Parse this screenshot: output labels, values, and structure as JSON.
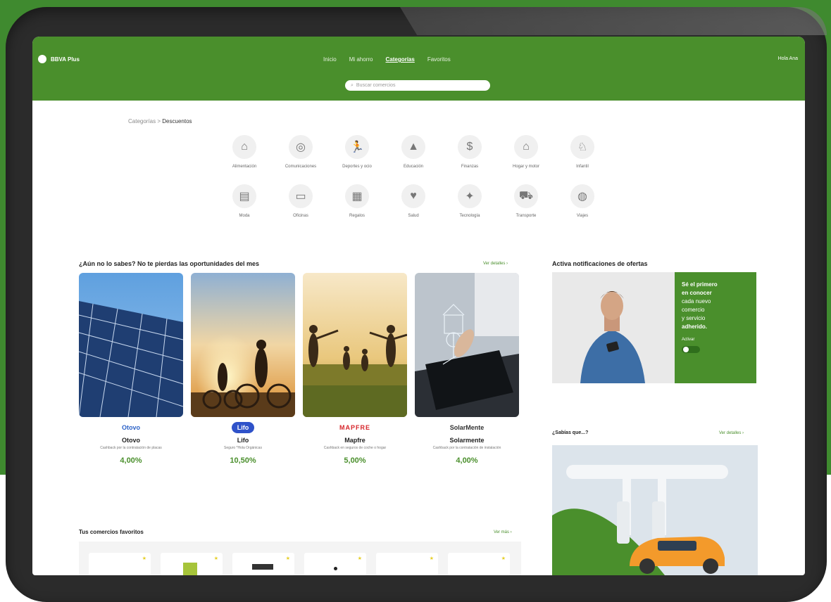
{
  "header": {
    "logo_text": "BBVA Plus",
    "nav": [
      "Inicio",
      "Mi ahorro",
      "Categorías",
      "Favoritos"
    ],
    "active_nav_index": 2,
    "user_label": "Hola Ana",
    "search_placeholder": "Buscar comercios"
  },
  "breadcrumb": {
    "parent": "Categorías",
    "separator": ">",
    "current": "Descuentos"
  },
  "categories": [
    {
      "label": "Alimentación",
      "icon": "basket-icon"
    },
    {
      "label": "Comunicaciones",
      "icon": "camera-icon"
    },
    {
      "label": "Deportes y ocio",
      "icon": "runner-icon"
    },
    {
      "label": "Educación",
      "icon": "graduation-cap-icon"
    },
    {
      "label": "Finanzas",
      "icon": "dollar-icon"
    },
    {
      "label": "Hogar y motor",
      "icon": "house-icon"
    },
    {
      "label": "Infantil",
      "icon": "stroller-icon"
    },
    {
      "label": "Moda",
      "icon": "clothing-icon"
    },
    {
      "label": "Oficinas",
      "icon": "document-icon"
    },
    {
      "label": "Regalos",
      "icon": "gift-icon"
    },
    {
      "label": "Salud",
      "icon": "heart-icon"
    },
    {
      "label": "Tecnología",
      "icon": "lightbulb-icon"
    },
    {
      "label": "Transporte",
      "icon": "car-icon"
    },
    {
      "label": "Viajes",
      "icon": "globe-icon"
    }
  ],
  "offers": {
    "title": "¿Aún no lo sabes? No te pierdas las oportunidades del mes",
    "see_all": "Ver detalles ›",
    "cards": [
      {
        "brand": "Otovo",
        "name": "Otovo",
        "desc": "Cashback por la contratación de placas",
        "rate": "4,00%"
      },
      {
        "brand": "Lifo",
        "name": "Lifo",
        "desc": "Seguro *Hola Orgánicas",
        "rate": "10,50%"
      },
      {
        "brand": "MAPFRE",
        "name": "Mapfre",
        "desc": "Cashback en seguros de coche o hogar",
        "rate": "5,00%"
      },
      {
        "brand": "SolarMente",
        "name": "Solarmente",
        "desc": "Cashback por la contratación de instalación",
        "rate": "4,00%"
      }
    ]
  },
  "notifications": {
    "title": "Activa notificaciones de ofertas",
    "promo_text": [
      "Sé el primero",
      "en conocer",
      "cada nuevo",
      "comercio",
      "y servicio",
      "adherido."
    ],
    "toggle_label": "Activar",
    "toggle_on": true
  },
  "did_you_know": {
    "title": "¿Sabías que...?",
    "see_all": "Ver detalles ›"
  },
  "favorites": {
    "title": "Tus comercios favoritos",
    "see_all": "Ver más ›",
    "count": 6
  },
  "colors": {
    "brand_green": "#4a8f2c",
    "frame": "#2b2b2b",
    "star": "#e6cf28"
  }
}
